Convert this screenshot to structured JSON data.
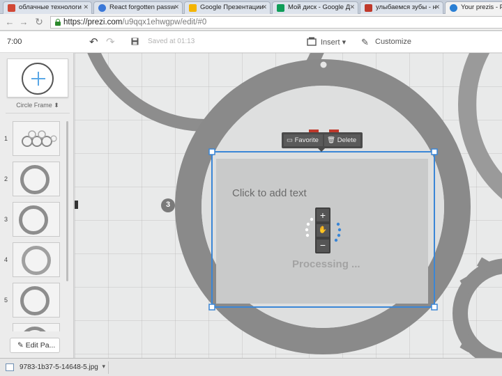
{
  "browser": {
    "tabs": [
      {
        "label": "облачные технологи",
        "icon": "document-favicon",
        "color": "#d14836"
      },
      {
        "label": "React forgotten passw",
        "icon": "globe-favicon",
        "color": "#3b78d8"
      },
      {
        "label": "Google Презентации",
        "icon": "slides-favicon",
        "color": "#f4b400"
      },
      {
        "label": "Мой диск - Google Д",
        "icon": "drive-favicon",
        "color": "#0f9d58"
      },
      {
        "label": "улыбаемся зубы - н",
        "icon": "image-favicon",
        "color": "#c0392b"
      },
      {
        "label": "Your prezis - Prezi",
        "icon": "prezi-favicon",
        "color": "#2a7fd4",
        "active": true
      }
    ],
    "back_icon": "back-arrow-icon",
    "forward_icon": "forward-arrow-icon",
    "reload_icon": "reload-icon",
    "url_host": "https://prezi.com",
    "url_path": "/u9qqx1ehwgpw/edit/#0"
  },
  "toolbar": {
    "time": "7:00",
    "undo_icon": "undo-icon",
    "redo_icon": "redo-icon",
    "save_icon": "floppy-icon",
    "saved_label": "Saved at 01:13",
    "insert_label": "Insert",
    "customize_label": "Customize"
  },
  "sidebar": {
    "frame_type_label": "Circle Frame",
    "thumbnails": [
      {
        "number": "1"
      },
      {
        "number": "2"
      },
      {
        "number": "3"
      },
      {
        "number": "4"
      },
      {
        "number": "5"
      }
    ],
    "edit_path_label": "Edit Pa..."
  },
  "canvas": {
    "frame_number": "3",
    "placeholder_text": "Click to add text",
    "processing_text": "Processing ...",
    "context_menu": {
      "favorite_label": "Favorite",
      "delete_label": "Delete"
    },
    "zoom_in": "+",
    "zoom_out": "−",
    "accent_color": "#3a86d6"
  },
  "downloads": {
    "file_name": "9783-1b37-5-14648-5.jpg"
  }
}
